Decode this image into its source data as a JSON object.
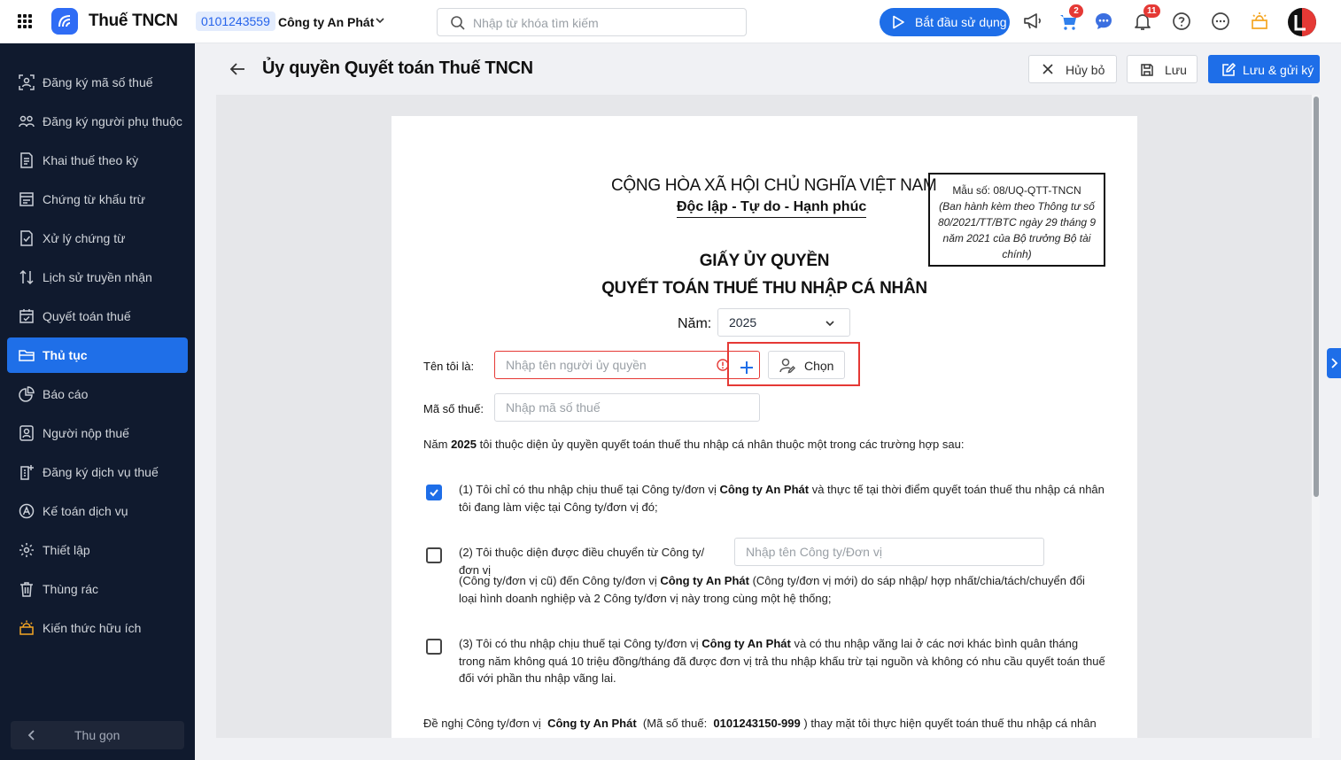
{
  "app": {
    "title": "Thuế TNCN",
    "tax_id": "0101243559",
    "company": "Công ty An Phát"
  },
  "search": {
    "placeholder": "Nhập từ khóa tìm kiếm"
  },
  "topbar": {
    "start_label": "Bắt đầu sử dụng",
    "cart_badge": "2",
    "notification_badge": "11"
  },
  "sidebar": {
    "items": [
      {
        "label": "Đăng ký mã số thuế",
        "icon": "id-scan-icon"
      },
      {
        "label": "Đăng ký người phụ thuộc",
        "icon": "users-icon"
      },
      {
        "label": "Khai thuế theo kỳ",
        "icon": "document-icon"
      },
      {
        "label": "Chứng từ khấu trừ",
        "icon": "receipt-icon"
      },
      {
        "label": "Xử lý chứng từ",
        "icon": "check-document-icon"
      },
      {
        "label": "Lịch sử truyền nhận",
        "icon": "transfer-icon"
      },
      {
        "label": "Quyết toán thuế",
        "icon": "calendar-check-icon"
      },
      {
        "label": "Thủ tục",
        "icon": "folder-icon",
        "active": true
      },
      {
        "label": "Báo cáo",
        "icon": "pie-chart-icon"
      },
      {
        "label": "Người nộp thuế",
        "icon": "person-card-icon"
      },
      {
        "label": "Đăng ký dịch vụ thuế",
        "icon": "service-icon"
      },
      {
        "label": "Kế toán dịch vụ",
        "icon": "accounting-icon"
      },
      {
        "label": "Thiết lập",
        "icon": "gear-icon"
      },
      {
        "label": "Thùng rác",
        "icon": "trash-icon"
      },
      {
        "label": "Kiến thức hữu ích",
        "icon": "lightbulb-icon"
      }
    ],
    "collapse_label": "Thu gọn"
  },
  "header": {
    "title": "Ủy quyền Quyết toán Thuế TNCN",
    "cancel_label": "Hủy bỏ",
    "save_label": "Lưu",
    "save_send_label": "Lưu & gửi ký"
  },
  "document": {
    "nation": "CỘNG HÒA XÃ HỘI CHỦ NGHĨA VIỆT NAM",
    "motto": "Độc lập - Tự do - Hạnh phúc",
    "form_code": "Mẫu số: 08/UQ-QTT-TNCN",
    "form_note": "(Ban hành kèm theo Thông tư số 80/2021/TT/BTC ngày 29 tháng 9 năm 2021 của Bộ trưởng Bộ tài chính)",
    "title": "GIẤY ỦY QUYỀN",
    "subtitle": "QUYẾT TOÁN THUẾ THU NHẬP CÁ NHÂN",
    "year_label": "Năm:",
    "year_value": "2025",
    "name_label": "Tên tôi là:",
    "name_placeholder": "Nhập tên người ủy quyền",
    "choose_label": "Chọn",
    "tax_label": "Mã số thuế:",
    "tax_placeholder": "Nhập mã số thuế",
    "intro_prefix": "Năm",
    "intro_year": "2025",
    "intro_text": "tôi thuộc diện ủy quyền quyết toán thuế thu nhập cá nhân thuộc một trong các trường hợp sau:",
    "option1_a": "(1) Tôi chỉ có thu nhập chịu thuế tại Công ty/đơn vị",
    "option1_company": "Công ty An Phát",
    "option1_b": "và thực tế tại thời điểm quyết toán thuế thu nhập cá nhân tôi đang làm việc tại Công ty/đơn vị đó;",
    "option1_checked": true,
    "option2_a": "(2) Tôi thuộc diện được điều chuyển từ Công ty/đơn vị",
    "option2_placeholder": "Nhập tên Công ty/Đơn vị",
    "option2_b": "(Công ty/đơn vị cũ) đến Công ty/đơn vị",
    "option2_company": "Công ty An Phát",
    "option2_c": "(Công ty/đơn vị mới) do sáp nhập/ hợp nhất/chia/tách/chuyển đổi loại hình doanh nghiệp và 2 Công ty/đơn vị này trong cùng một hệ thống;",
    "option2_checked": false,
    "option3_a": "(3) Tôi có thu nhập chịu thuế tại Công ty/đơn vị",
    "option3_company": "Công ty An Phát",
    "option3_b": "và có thu nhập vãng lai ở các nơi khác bình quân tháng trong năm không quá 10 triệu đồng/tháng đã được đơn vị trả thu nhập khấu trừ tại nguồn và không có nhu cầu quyết toán thuế đối với phần thu nhập vãng lai.",
    "option3_checked": false,
    "request_a": "Đề nghị Công ty/đơn vị",
    "request_company": "Công ty An Phát",
    "request_b": "(Mã số thuế:",
    "request_tax": "0101243150-999",
    "request_c": ") thay mặt tôi thực hiện quyết toán thuế thu nhập cá nhân"
  },
  "colors": {
    "accent": "#1e6ee8",
    "sidebar_bg": "#101a2e",
    "error": "#e53935"
  }
}
